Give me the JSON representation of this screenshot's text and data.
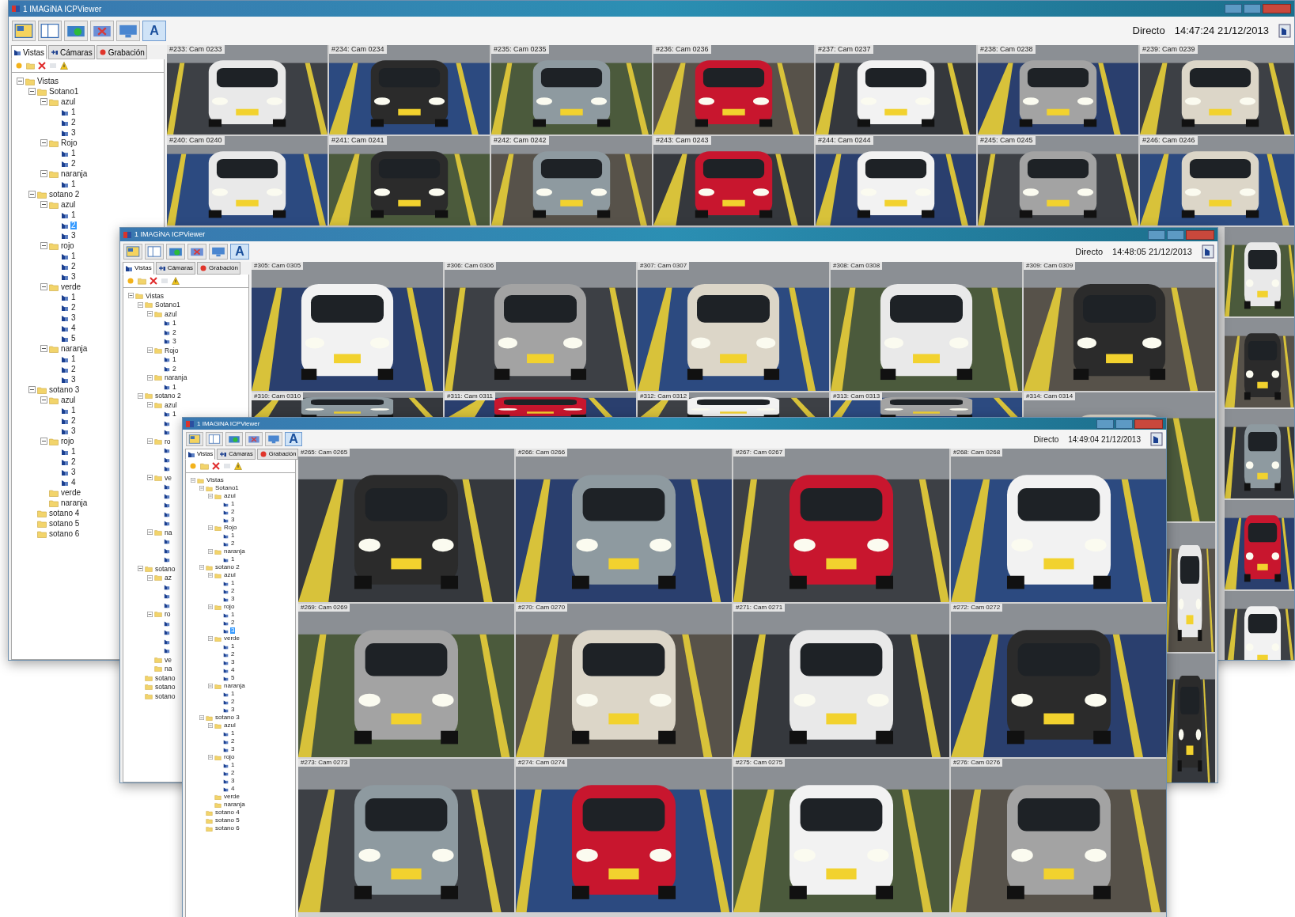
{
  "windows": [
    {
      "title": "1 IMAGiNA ICPViewer",
      "mode": "Directo",
      "timestamp": "14:47:24 21/12/2013",
      "toolbar": [
        {
          "kind": "layout"
        },
        {
          "kind": "panel"
        },
        {
          "kind": "camera-add"
        },
        {
          "kind": "camera-remove"
        },
        {
          "kind": "monitor"
        },
        {
          "kind": "text",
          "label": "A"
        }
      ],
      "tabs": [
        {
          "label": "Vistas",
          "selected": true
        },
        {
          "label": "Cámaras",
          "selected": false
        },
        {
          "label": "Grabación",
          "selected": false
        }
      ],
      "tree": [
        {
          "kind": "folder",
          "label": "Vistas",
          "selected": false,
          "children": [
            {
              "kind": "folder",
              "label": "Sotano1",
              "selected": false,
              "children": [
                {
                  "kind": "folder",
                  "label": "azul",
                  "selected": false,
                  "children": [
                    {
                      "kind": "camera",
                      "label": "1",
                      "selected": false
                    },
                    {
                      "kind": "camera",
                      "label": "2",
                      "selected": false
                    },
                    {
                      "kind": "camera",
                      "label": "3",
                      "selected": false
                    }
                  ]
                },
                {
                  "kind": "folder",
                  "label": "Rojo",
                  "selected": false,
                  "children": [
                    {
                      "kind": "camera",
                      "label": "1",
                      "selected": false
                    },
                    {
                      "kind": "camera",
                      "label": "2",
                      "selected": false
                    }
                  ]
                },
                {
                  "kind": "folder",
                  "label": "naranja",
                  "selected": false,
                  "children": [
                    {
                      "kind": "camera",
                      "label": "1",
                      "selected": false
                    }
                  ]
                }
              ]
            },
            {
              "kind": "folder",
              "label": "sotano 2",
              "selected": false,
              "children": [
                {
                  "kind": "folder",
                  "label": "azul",
                  "selected": false,
                  "children": [
                    {
                      "kind": "camera",
                      "label": "1",
                      "selected": false
                    },
                    {
                      "kind": "camera",
                      "label": "2",
                      "selected": true
                    },
                    {
                      "kind": "camera",
                      "label": "3",
                      "selected": false
                    }
                  ]
                },
                {
                  "kind": "folder",
                  "label": "rojo",
                  "selected": false,
                  "children": [
                    {
                      "kind": "camera",
                      "label": "1",
                      "selected": false
                    },
                    {
                      "kind": "camera",
                      "label": "2",
                      "selected": false
                    },
                    {
                      "kind": "camera",
                      "label": "3",
                      "selected": false
                    }
                  ]
                },
                {
                  "kind": "folder",
                  "label": "verde",
                  "selected": false,
                  "children": [
                    {
                      "kind": "camera",
                      "label": "1",
                      "selected": false
                    },
                    {
                      "kind": "camera",
                      "label": "2",
                      "selected": false
                    },
                    {
                      "kind": "camera",
                      "label": "3",
                      "selected": false
                    },
                    {
                      "kind": "camera",
                      "label": "4",
                      "selected": false
                    },
                    {
                      "kind": "camera",
                      "label": "5",
                      "selected": false
                    }
                  ]
                },
                {
                  "kind": "folder",
                  "label": "naranja",
                  "selected": false,
                  "children": [
                    {
                      "kind": "camera",
                      "label": "1",
                      "selected": false
                    },
                    {
                      "kind": "camera",
                      "label": "2",
                      "selected": false
                    },
                    {
                      "kind": "camera",
                      "label": "3",
                      "selected": false
                    }
                  ]
                }
              ]
            },
            {
              "kind": "folder",
              "label": "sotano 3",
              "selected": false,
              "children": [
                {
                  "kind": "folder",
                  "label": "azul",
                  "selected": false,
                  "children": [
                    {
                      "kind": "camera",
                      "label": "1",
                      "selected": false
                    },
                    {
                      "kind": "camera",
                      "label": "2",
                      "selected": false
                    },
                    {
                      "kind": "camera",
                      "label": "3",
                      "selected": false
                    }
                  ]
                },
                {
                  "kind": "folder",
                  "label": "rojo",
                  "selected": false,
                  "children": [
                    {
                      "kind": "camera",
                      "label": "1",
                      "selected": false
                    },
                    {
                      "kind": "camera",
                      "label": "2",
                      "selected": false
                    },
                    {
                      "kind": "camera",
                      "label": "3",
                      "selected": false
                    },
                    {
                      "kind": "camera",
                      "label": "4",
                      "selected": false
                    }
                  ]
                },
                {
                  "kind": "folder",
                  "label": "verde",
                  "selected": false
                },
                {
                  "kind": "folder",
                  "label": "naranja",
                  "selected": false
                }
              ]
            },
            {
              "kind": "folder",
              "label": "sotano 4",
              "selected": false
            },
            {
              "kind": "folder",
              "label": "sotano 5",
              "selected": false
            },
            {
              "kind": "folder",
              "label": "sotano 6",
              "selected": false
            }
          ]
        }
      ],
      "tiles": [
        {
          "kind": "camera",
          "label": "#233: Cam 0233"
        },
        {
          "kind": "camera",
          "label": "#234: Cam 0234"
        },
        {
          "kind": "camera",
          "label": "#235: Cam 0235"
        },
        {
          "kind": "camera",
          "label": "#236: Cam 0236"
        },
        {
          "kind": "camera",
          "label": "#237: Cam 0237"
        },
        {
          "kind": "camera",
          "label": "#238: Cam 0238"
        },
        {
          "kind": "camera",
          "label": "#239: Cam 0239"
        },
        {
          "kind": "camera",
          "label": "#240: Cam 0240"
        },
        {
          "kind": "camera",
          "label": "#241: Cam 0241"
        },
        {
          "kind": "camera",
          "label": "#242: Cam 0242"
        },
        {
          "kind": "camera",
          "label": "#243: Cam 0243"
        },
        {
          "kind": "camera",
          "label": "#244: Cam 0244"
        },
        {
          "kind": "camera",
          "label": "#245: Cam 0245"
        },
        {
          "kind": "camera",
          "label": "#246: Cam 0246"
        },
        {
          "kind": "picture"
        },
        {
          "kind": "picture"
        },
        {
          "kind": "picture"
        },
        {
          "kind": "picture"
        },
        {
          "kind": "picture"
        }
      ]
    },
    {
      "title": "1 IMAGiNA ICPViewer",
      "mode": "Directo",
      "timestamp": "14:48:05 21/12/2013",
      "toolbar": [
        {
          "kind": "layout"
        },
        {
          "kind": "panel"
        },
        {
          "kind": "camera-add"
        },
        {
          "kind": "camera-remove"
        },
        {
          "kind": "monitor"
        },
        {
          "kind": "text",
          "label": "A"
        }
      ],
      "tabs": [
        {
          "label": "Vistas",
          "selected": true
        },
        {
          "label": "Cámaras",
          "selected": false
        },
        {
          "label": "Grabación",
          "selected": false
        }
      ],
      "tree": [
        {
          "kind": "folder",
          "label": "Vistas",
          "selected": false,
          "children": [
            {
              "kind": "folder",
              "label": "Sotano1",
              "selected": false,
              "children": [
                {
                  "kind": "folder",
                  "label": "azul",
                  "selected": false,
                  "children": [
                    {
                      "kind": "camera",
                      "label": "1",
                      "selected": false
                    },
                    {
                      "kind": "camera",
                      "label": "2",
                      "selected": false
                    },
                    {
                      "kind": "camera",
                      "label": "3",
                      "selected": false
                    }
                  ]
                },
                {
                  "kind": "folder",
                  "label": "Rojo",
                  "selected": false,
                  "children": [
                    {
                      "kind": "camera",
                      "label": "1",
                      "selected": false
                    },
                    {
                      "kind": "camera",
                      "label": "2",
                      "selected": false
                    }
                  ]
                },
                {
                  "kind": "folder",
                  "label": "naranja",
                  "selected": false,
                  "children": [
                    {
                      "kind": "camera",
                      "label": "1",
                      "selected": false
                    }
                  ]
                }
              ]
            },
            {
              "kind": "folder",
              "label": "sotano 2",
              "selected": false,
              "children": [
                {
                  "kind": "folder",
                  "label": "azul",
                  "selected": false,
                  "children": [
                    {
                      "kind": "camera",
                      "label": "1",
                      "selected": false
                    },
                    {
                      "kind": "camera"
                    },
                    {
                      "kind": "camera"
                    }
                  ]
                },
                {
                  "kind": "folder",
                  "label": "ro",
                  "selected": false,
                  "children": [
                    {
                      "kind": "camera"
                    },
                    {
                      "kind": "camera"
                    },
                    {
                      "kind": "camera"
                    }
                  ]
                },
                {
                  "kind": "folder",
                  "label": "ve",
                  "selected": false,
                  "children": [
                    {
                      "kind": "camera"
                    },
                    {
                      "kind": "camera"
                    },
                    {
                      "kind": "camera"
                    },
                    {
                      "kind": "camera"
                    },
                    {
                      "kind": "camera"
                    }
                  ]
                },
                {
                  "kind": "folder",
                  "label": "na",
                  "selected": false,
                  "children": [
                    {
                      "kind": "camera"
                    },
                    {
                      "kind": "camera"
                    },
                    {
                      "kind": "camera"
                    }
                  ]
                }
              ]
            },
            {
              "kind": "folder",
              "label": "sotano",
              "selected": false,
              "children": [
                {
                  "kind": "folder",
                  "label": "az",
                  "selected": false,
                  "children": [
                    {
                      "kind": "camera"
                    },
                    {
                      "kind": "camera"
                    },
                    {
                      "kind": "camera"
                    }
                  ]
                },
                {
                  "kind": "folder",
                  "label": "ro",
                  "selected": false,
                  "children": [
                    {
                      "kind": "camera"
                    },
                    {
                      "kind": "camera"
                    },
                    {
                      "kind": "camera"
                    },
                    {
                      "kind": "camera"
                    }
                  ]
                },
                {
                  "kind": "folder",
                  "label": "ve",
                  "selected": false
                },
                {
                  "kind": "folder",
                  "label": "na",
                  "selected": false
                }
              ]
            },
            {
              "kind": "folder",
              "label": "sotano",
              "selected": false
            },
            {
              "kind": "folder",
              "label": "sotano",
              "selected": false
            },
            {
              "kind": "folder",
              "label": "sotano",
              "selected": false
            }
          ]
        }
      ],
      "tiles": [
        {
          "kind": "camera",
          "label": "#305: Cam 0305"
        },
        {
          "kind": "camera",
          "label": "#306: Cam 0306"
        },
        {
          "kind": "camera",
          "label": "#307: Cam 0307"
        },
        {
          "kind": "camera",
          "label": "#308: Cam 0308"
        },
        {
          "kind": "camera",
          "label": "#309: Cam 0309"
        },
        {
          "kind": "camera",
          "label": "#310: Cam 0310"
        },
        {
          "kind": "camera",
          "label": "#311: Cam 0311"
        },
        {
          "kind": "camera",
          "label": "#312: Cam 0312"
        },
        {
          "kind": "camera",
          "label": "#313: Cam 0313"
        },
        {
          "kind": "camera",
          "label": "#314: Cam 0314"
        },
        {
          "kind": "picture"
        },
        {
          "kind": "picture"
        }
      ]
    },
    {
      "title": "1 IMAGiNA ICPViewer",
      "mode": "Directo",
      "timestamp": "14:49:04 21/12/2013",
      "toolbar": [
        {
          "kind": "layout"
        },
        {
          "kind": "panel"
        },
        {
          "kind": "camera-add"
        },
        {
          "kind": "camera-remove"
        },
        {
          "kind": "monitor"
        },
        {
          "kind": "text",
          "label": "A"
        }
      ],
      "tabs": [
        {
          "label": "Vistas",
          "selected": true
        },
        {
          "label": "Cámaras",
          "selected": false
        },
        {
          "label": "Grabación",
          "selected": false
        }
      ],
      "tree": [
        {
          "kind": "folder",
          "label": "Vistas",
          "selected": false,
          "children": [
            {
              "kind": "folder",
              "label": "Sotano1",
              "selected": false,
              "children": [
                {
                  "kind": "folder",
                  "label": "azul",
                  "selected": false,
                  "children": [
                    {
                      "kind": "camera",
                      "label": "1",
                      "selected": false
                    },
                    {
                      "kind": "camera",
                      "label": "2",
                      "selected": false
                    },
                    {
                      "kind": "camera",
                      "label": "3",
                      "selected": false
                    }
                  ]
                },
                {
                  "kind": "folder",
                  "label": "Rojo",
                  "selected": false,
                  "children": [
                    {
                      "kind": "camera",
                      "label": "1",
                      "selected": false
                    },
                    {
                      "kind": "camera",
                      "label": "2",
                      "selected": false
                    }
                  ]
                },
                {
                  "kind": "folder",
                  "label": "naranja",
                  "selected": false,
                  "children": [
                    {
                      "kind": "camera",
                      "label": "1",
                      "selected": false
                    }
                  ]
                }
              ]
            },
            {
              "kind": "folder",
              "label": "sotano 2",
              "selected": false,
              "children": [
                {
                  "kind": "folder",
                  "label": "azul",
                  "selected": false,
                  "children": [
                    {
                      "kind": "camera",
                      "label": "1",
                      "selected": false
                    },
                    {
                      "kind": "camera",
                      "label": "2",
                      "selected": false
                    },
                    {
                      "kind": "camera",
                      "label": "3",
                      "selected": false
                    }
                  ]
                },
                {
                  "kind": "folder",
                  "label": "rojo",
                  "selected": false,
                  "children": [
                    {
                      "kind": "camera",
                      "label": "1",
                      "selected": false
                    },
                    {
                      "kind": "camera",
                      "label": "2",
                      "selected": false
                    },
                    {
                      "kind": "camera",
                      "label": "3",
                      "selected": true
                    }
                  ]
                },
                {
                  "kind": "folder",
                  "label": "verde",
                  "selected": false,
                  "children": [
                    {
                      "kind": "camera",
                      "label": "1",
                      "selected": false
                    },
                    {
                      "kind": "camera",
                      "label": "2",
                      "selected": false
                    },
                    {
                      "kind": "camera",
                      "label": "3",
                      "selected": false
                    },
                    {
                      "kind": "camera",
                      "label": "4",
                      "selected": false
                    },
                    {
                      "kind": "camera",
                      "label": "5",
                      "selected": false
                    }
                  ]
                },
                {
                  "kind": "folder",
                  "label": "naranja",
                  "selected": false,
                  "children": [
                    {
                      "kind": "camera",
                      "label": "1",
                      "selected": false
                    },
                    {
                      "kind": "camera",
                      "label": "2",
                      "selected": false
                    },
                    {
                      "kind": "camera",
                      "label": "3",
                      "selected": false
                    }
                  ]
                }
              ]
            },
            {
              "kind": "folder",
              "label": "sotano 3",
              "selected": false,
              "children": [
                {
                  "kind": "folder",
                  "label": "azul",
                  "selected": false,
                  "children": [
                    {
                      "kind": "camera",
                      "label": "1",
                      "selected": false
                    },
                    {
                      "kind": "camera",
                      "label": "2",
                      "selected": false
                    },
                    {
                      "kind": "camera",
                      "label": "3",
                      "selected": false
                    }
                  ]
                },
                {
                  "kind": "folder",
                  "label": "rojo",
                  "selected": false,
                  "children": [
                    {
                      "kind": "camera",
                      "label": "1",
                      "selected": false
                    },
                    {
                      "kind": "camera",
                      "label": "2",
                      "selected": false
                    },
                    {
                      "kind": "camera",
                      "label": "3",
                      "selected": false
                    },
                    {
                      "kind": "camera",
                      "label": "4",
                      "selected": false
                    }
                  ]
                },
                {
                  "kind": "folder",
                  "label": "verde",
                  "selected": false
                },
                {
                  "kind": "folder",
                  "label": "naranja",
                  "selected": false
                }
              ]
            },
            {
              "kind": "folder",
              "label": "sotano 4",
              "selected": false
            },
            {
              "kind": "folder",
              "label": "sotano 5",
              "selected": false
            },
            {
              "kind": "folder",
              "label": "sotano 6",
              "selected": false
            }
          ]
        }
      ],
      "tiles": [
        {
          "kind": "camera",
          "label": "#265: Cam 0265"
        },
        {
          "kind": "camera",
          "label": "#266: Cam 0266"
        },
        {
          "kind": "camera",
          "label": "#267: Cam 0267"
        },
        {
          "kind": "camera",
          "label": "#268: Cam 0268"
        },
        {
          "kind": "camera",
          "label": "#269: Cam 0269"
        },
        {
          "kind": "camera",
          "label": "#270: Cam 0270"
        },
        {
          "kind": "camera",
          "label": "#271: Cam 0271"
        },
        {
          "kind": "camera",
          "label": "#272: Cam 0272"
        },
        {
          "kind": "camera",
          "label": "#273: Cam 0273"
        },
        {
          "kind": "camera",
          "label": "#274: Cam 0274"
        },
        {
          "kind": "camera",
          "label": "#275: Cam 0275"
        },
        {
          "kind": "camera",
          "label": "#276: Cam 0276"
        }
      ]
    }
  ]
}
